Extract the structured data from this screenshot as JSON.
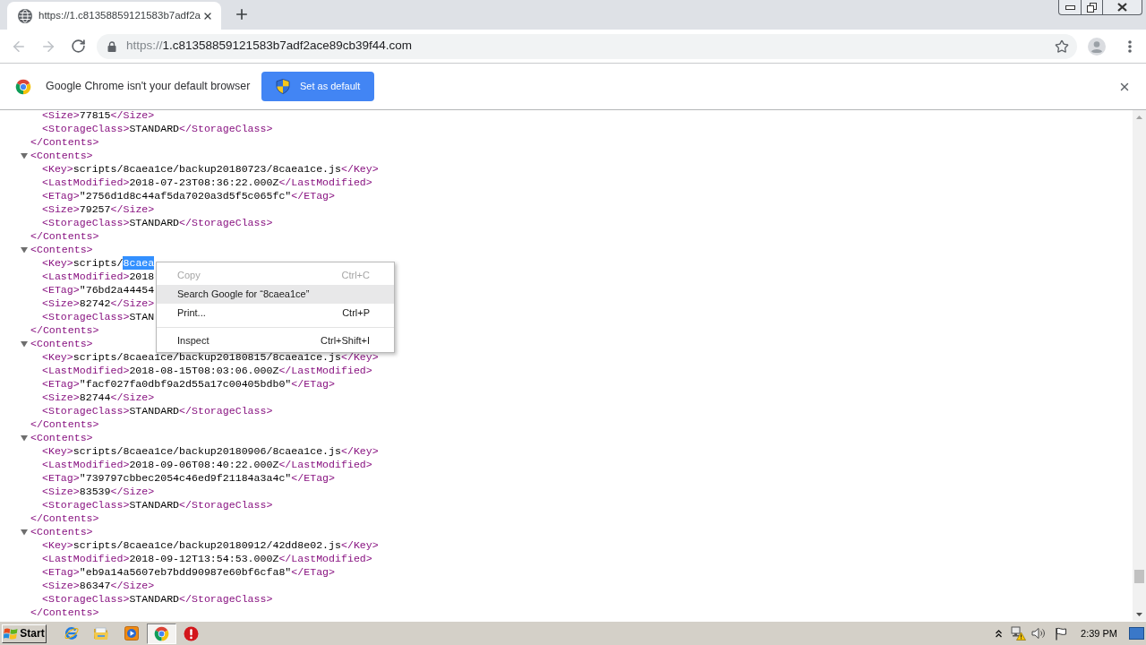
{
  "browser": {
    "tabs": [
      {
        "title": "https://1.c81358859121583b7adf2a",
        "selected": true
      }
    ],
    "back": {
      "disabled": true
    },
    "forward": {
      "disabled": true
    },
    "address_bar": {
      "scheme": "https://",
      "host": "1.c81358859121583b7adf2ace89cb39f44.com"
    }
  },
  "infobar": {
    "message": "Google Chrome isn't your default browser",
    "button": "Set as default"
  },
  "xml_view": {
    "blocks": [
      {
        "children": [
          {
            "open": "<Size>",
            "text": "77815",
            "close": "</Size>"
          },
          {
            "open": "<StorageClass>",
            "text": "STANDARD",
            "close": "</StorageClass>"
          }
        ],
        "close": "</Contents>"
      },
      {
        "expanded": true,
        "open": "<Contents>",
        "children": [
          {
            "open": "<Key>",
            "text": "scripts/8caea1ce/backup20180723/8caea1ce.js",
            "close": "</Key>"
          },
          {
            "open": "<LastModified>",
            "text": "2018-07-23T08:36:22.000Z",
            "close": "</LastModified>"
          },
          {
            "open": "<ETag>",
            "text": "\"2756d1d8c44af5da7020a3d5f5c065fc\"",
            "close": "</ETag>"
          },
          {
            "open": "<Size>",
            "text": "79257",
            "close": "</Size>"
          },
          {
            "open": "<StorageClass>",
            "text": "STANDARD",
            "close": "</StorageClass>"
          }
        ],
        "close": "</Contents>"
      },
      {
        "expanded": true,
        "open": "<Contents>",
        "children": [
          {
            "open": "<Key>",
            "text": "scripts/",
            "selected_text": "8caea"
          },
          {
            "open": "<LastModified>",
            "text": "2018"
          },
          {
            "open": "<ETag>",
            "text": "\"76bd2a44454"
          },
          {
            "open": "<Size>",
            "text": "82742",
            "close": "</Size>"
          },
          {
            "open": "<StorageClass>",
            "text": "STAN"
          }
        ],
        "close": "</Contents>"
      },
      {
        "expanded": true,
        "open": "<Contents>",
        "children": [
          {
            "open": "<Key>",
            "text": "scripts/8caea1ce/backup20180815/8caea1ce.js",
            "close": "</Key>"
          },
          {
            "open": "<LastModified>",
            "text": "2018-08-15T08:03:06.000Z",
            "close": "</LastModified>"
          },
          {
            "open": "<ETag>",
            "text": "\"facf027fa0dbf9a2d55a17c00405bdb0\"",
            "close": "</ETag>"
          },
          {
            "open": "<Size>",
            "text": "82744",
            "close": "</Size>"
          },
          {
            "open": "<StorageClass>",
            "text": "STANDARD",
            "close": "</StorageClass>"
          }
        ],
        "close": "</Contents>"
      },
      {
        "expanded": true,
        "open": "<Contents>",
        "children": [
          {
            "open": "<Key>",
            "text": "scripts/8caea1ce/backup20180906/8caea1ce.js",
            "close": "</Key>"
          },
          {
            "open": "<LastModified>",
            "text": "2018-09-06T08:40:22.000Z",
            "close": "</LastModified>"
          },
          {
            "open": "<ETag>",
            "text": "\"739797cbbec2054c46ed9f21184a3a4c\"",
            "close": "</ETag>"
          },
          {
            "open": "<Size>",
            "text": "83539",
            "close": "</Size>"
          },
          {
            "open": "<StorageClass>",
            "text": "STANDARD",
            "close": "</StorageClass>"
          }
        ],
        "close": "</Contents>"
      },
      {
        "expanded": true,
        "open": "<Contents>",
        "children": [
          {
            "open": "<Key>",
            "text": "scripts/8caea1ce/backup20180912/42dd8e02.js",
            "close": "</Key>"
          },
          {
            "open": "<LastModified>",
            "text": "2018-09-12T13:54:53.000Z",
            "close": "</LastModified>"
          },
          {
            "open": "<ETag>",
            "text": "\"eb9a14a5607eb7bdd90987e60bf6cfa8\"",
            "close": "</ETag>"
          },
          {
            "open": "<Size>",
            "text": "86347",
            "close": "</Size>"
          },
          {
            "open": "<StorageClass>",
            "text": "STANDARD",
            "close": "</StorageClass>"
          }
        ],
        "close": "</Contents>"
      }
    ]
  },
  "context_menu": {
    "items": [
      {
        "kind": "item",
        "label": "Copy",
        "shortcut": "Ctrl+C",
        "disabled": true,
        "selected": false
      },
      {
        "kind": "item",
        "label": "Search Google for “8caea1ce”",
        "disabled": false,
        "selected": true
      },
      {
        "kind": "item",
        "label": "Print...",
        "shortcut": "Ctrl+P",
        "disabled": false,
        "selected": false
      },
      {
        "kind": "separator"
      },
      {
        "kind": "item",
        "label": "Inspect",
        "shortcut": "Ctrl+Shift+I",
        "disabled": false,
        "selected": false
      }
    ]
  },
  "taskbar": {
    "start": "Start",
    "apps": [
      {
        "kind": "e-logo",
        "selected": false
      },
      {
        "kind": "folder",
        "selected": false
      },
      {
        "kind": "media",
        "selected": false
      },
      {
        "kind": "chrome",
        "selected": true
      },
      {
        "kind": "alert",
        "selected": false
      }
    ],
    "clock": "2:39 PM"
  }
}
